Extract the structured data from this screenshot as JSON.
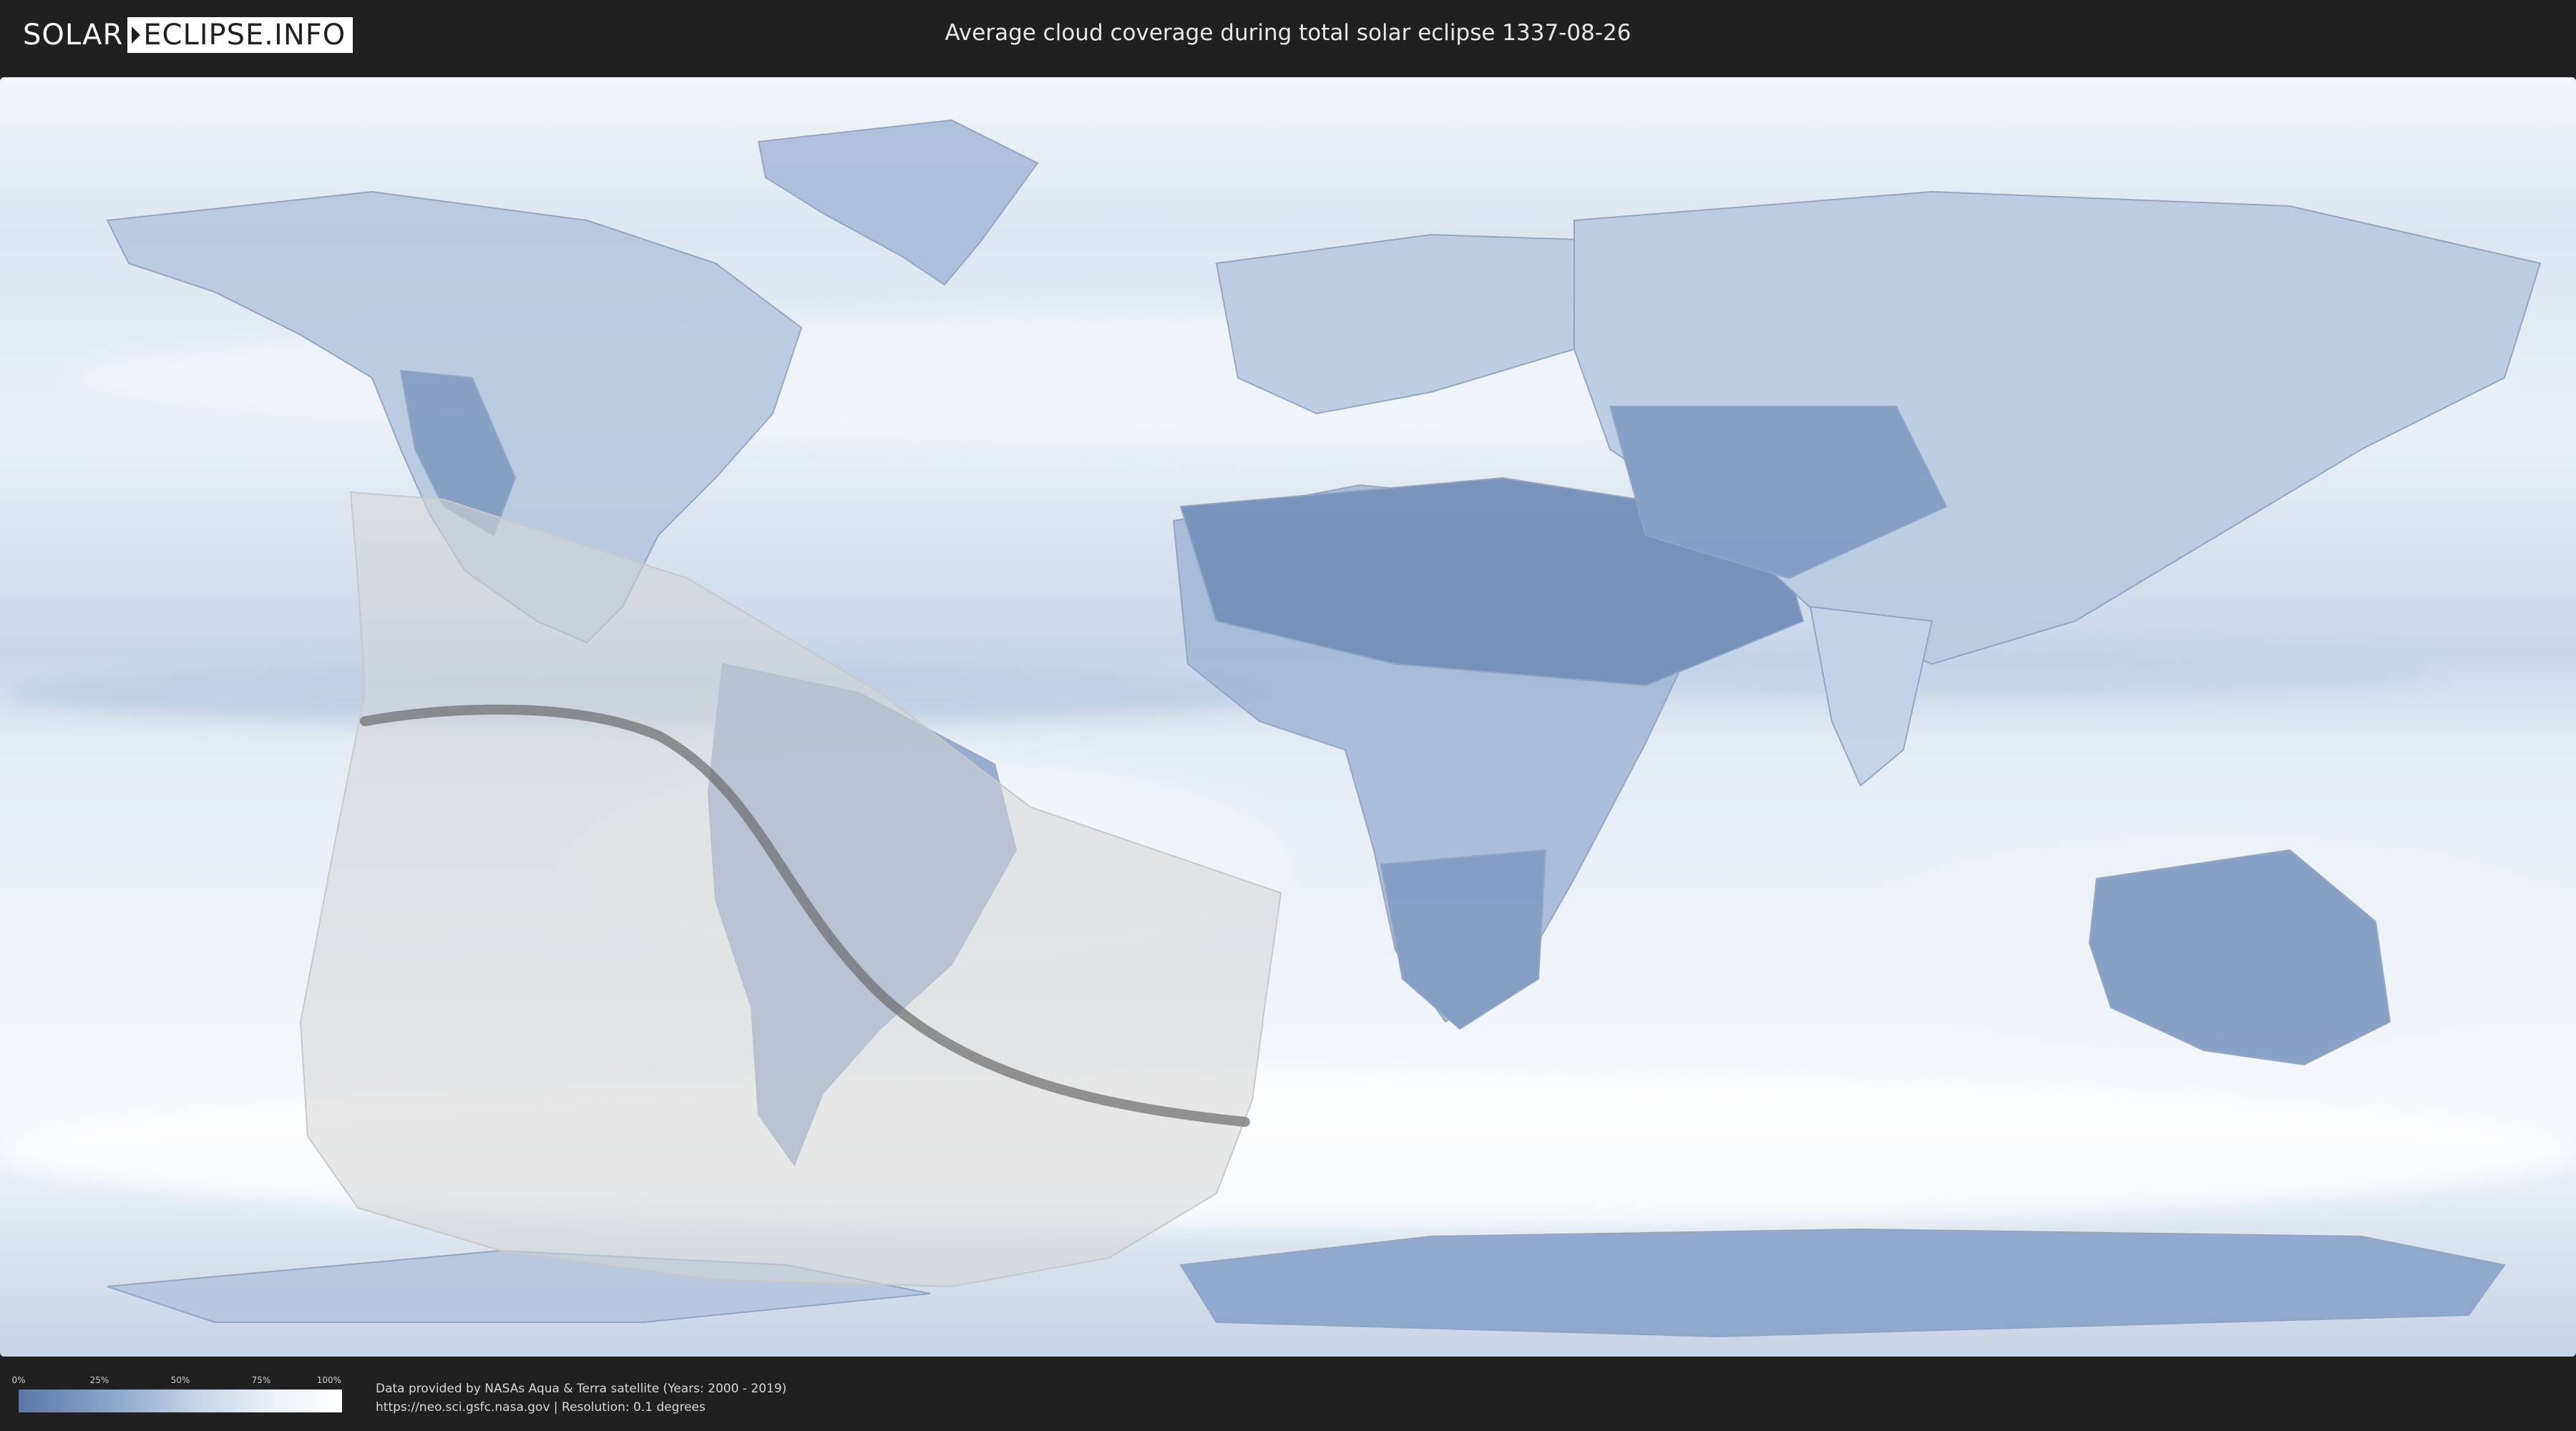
{
  "header": {
    "logo_left": "SOLAR",
    "logo_right": "ECLIPSE.INFO",
    "title": "Average cloud coverage during total solar eclipse 1337-08-26"
  },
  "map": {
    "type": "world cloud coverage map",
    "colors": {
      "clear": "#5a77a7",
      "cloudy": "#ffffff",
      "eclipse_zone": "#d9d9d9",
      "totality_path": "#6b6b6b"
    }
  },
  "legend": {
    "ticks": [
      "0%",
      "25%",
      "50%",
      "75%",
      "100%"
    ],
    "gradient_from": "#5a77a7",
    "gradient_to": "#ffffff"
  },
  "credits": {
    "line1": "Data provided by NASAs Aqua & Terra satellite (Years: 2000 - 2019)",
    "line2": "https://neo.sci.gsfc.nasa.gov | Resolution: 0.1 degrees"
  }
}
